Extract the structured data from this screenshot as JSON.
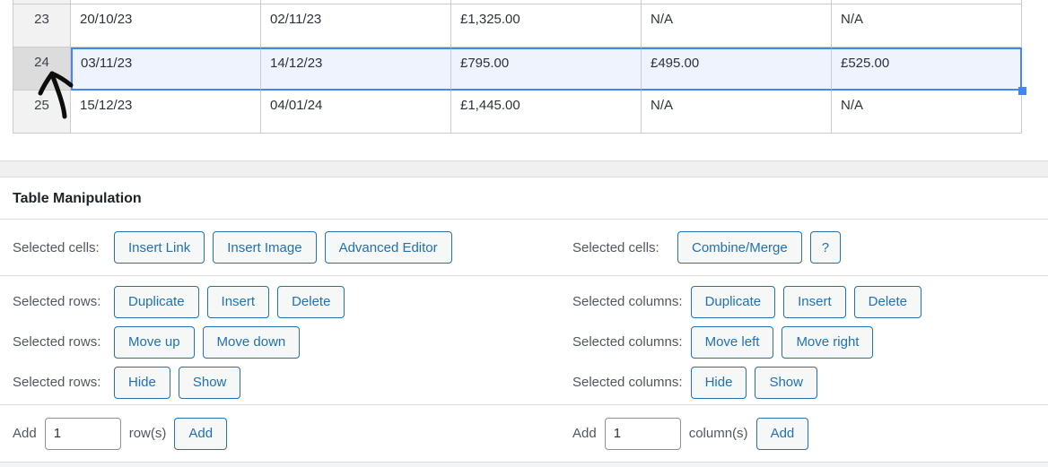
{
  "colors": {
    "accent_blue": "#2271b1",
    "selection_border": "#4285f4",
    "selection_fill": "#eef3fd",
    "band_gray": "#f0f0f1"
  },
  "spreadsheet": {
    "rows": [
      {
        "num": "23",
        "selected": false,
        "cells": [
          "20/10/23",
          "02/11/23",
          "£1,325.00",
          "N/A",
          "N/A"
        ]
      },
      {
        "num": "24",
        "selected": true,
        "cells": [
          "03/11/23",
          "14/12/23",
          "£795.00",
          "£495.00",
          "£525.00"
        ]
      },
      {
        "num": "25",
        "selected": false,
        "cells": [
          "15/12/23",
          "04/01/24",
          "£1,445.00",
          "N/A",
          "N/A"
        ]
      }
    ]
  },
  "panel": {
    "title": "Table Manipulation",
    "sections": [
      {
        "divider_after": true,
        "rows": [
          {
            "left": {
              "label": "Selected cells:",
              "buttons": [
                "Insert Link",
                "Insert Image",
                "Advanced Editor"
              ]
            },
            "right": {
              "label": "Selected cells:",
              "buttons": [
                "Combine/Merge",
                "?"
              ]
            }
          }
        ]
      },
      {
        "divider_after": true,
        "rows": [
          {
            "left": {
              "label": "Selected rows:",
              "buttons": [
                "Duplicate",
                "Insert",
                "Delete"
              ]
            },
            "right": {
              "label": "Selected columns:",
              "buttons": [
                "Duplicate",
                "Insert",
                "Delete"
              ]
            }
          },
          {
            "left": {
              "label": "Selected rows:",
              "buttons": [
                "Move up",
                "Move down"
              ]
            },
            "right": {
              "label": "Selected columns:",
              "buttons": [
                "Move left",
                "Move right"
              ]
            }
          },
          {
            "left": {
              "label": "Selected rows:",
              "buttons": [
                "Hide",
                "Show"
              ]
            },
            "right": {
              "label": "Selected columns:",
              "buttons": [
                "Hide",
                "Show"
              ]
            }
          }
        ]
      },
      {
        "divider_after": false,
        "rows": [
          {
            "left": {
              "add": {
                "prefix": "Add",
                "value": "1",
                "suffix": "row(s)",
                "button": "Add"
              }
            },
            "right": {
              "add": {
                "prefix": "Add",
                "value": "1",
                "suffix": "column(s)",
                "button": "Add"
              }
            }
          }
        ]
      }
    ]
  }
}
